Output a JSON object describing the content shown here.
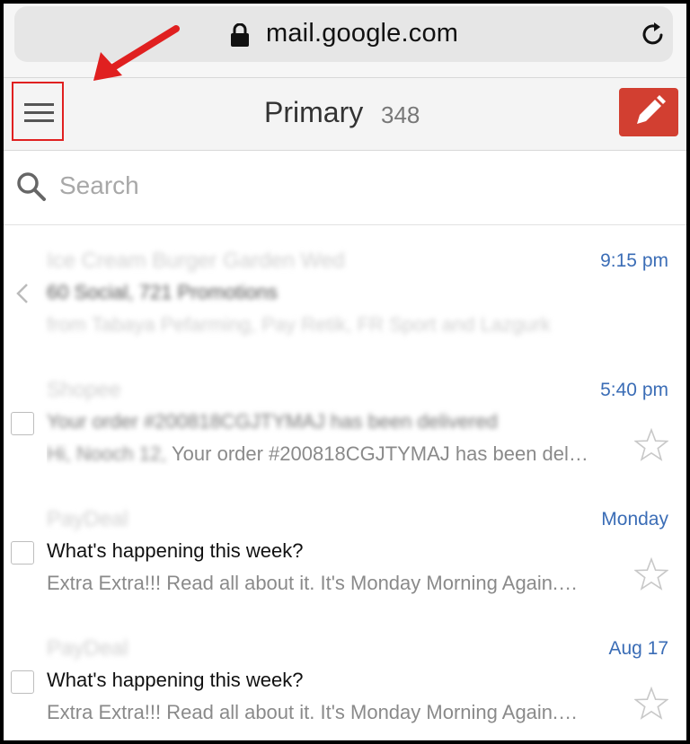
{
  "browser": {
    "url": "mail.google.com",
    "lock_icon": "lock-icon",
    "reload_icon": "reload-icon"
  },
  "header": {
    "title": "Primary",
    "count": "348",
    "menu_icon": "hamburger-menu-icon",
    "compose_icon": "pencil-icon",
    "compose_color": "#d23f31"
  },
  "search": {
    "placeholder": "Search"
  },
  "annotation": {
    "arrow_color": "#e02020",
    "highlight_color": "#e02020"
  },
  "messages": [
    {
      "sender": "Ice Cream Burger Garden Wed",
      "time": "9:15 pm",
      "subject": "60 Social, 721 Promotions",
      "snippet": "from Tabaya Pefarming, Pay Retik, FR Sport and Lazgurk"
    },
    {
      "sender": "Shopee",
      "time": "5:40 pm",
      "subject_hidden": "Your order #200818CGJTYMAJ has been delivered",
      "snippet_hidden": "Hi, Nooch 12,",
      "snippet_visible": "Your order #200818CGJTYMAJ has been del…"
    },
    {
      "sender": "PayDeal",
      "time": "Monday",
      "subject": "What's happening this week?",
      "snippet": "Extra Extra!!! Read all about it. It's Monday Morning Again.…"
    },
    {
      "sender": "PayDeal",
      "time": "Aug 17",
      "subject": "What's happening this week?",
      "snippet": "Extra Extra!!! Read all about it. It's Monday Morning Again.…"
    }
  ]
}
